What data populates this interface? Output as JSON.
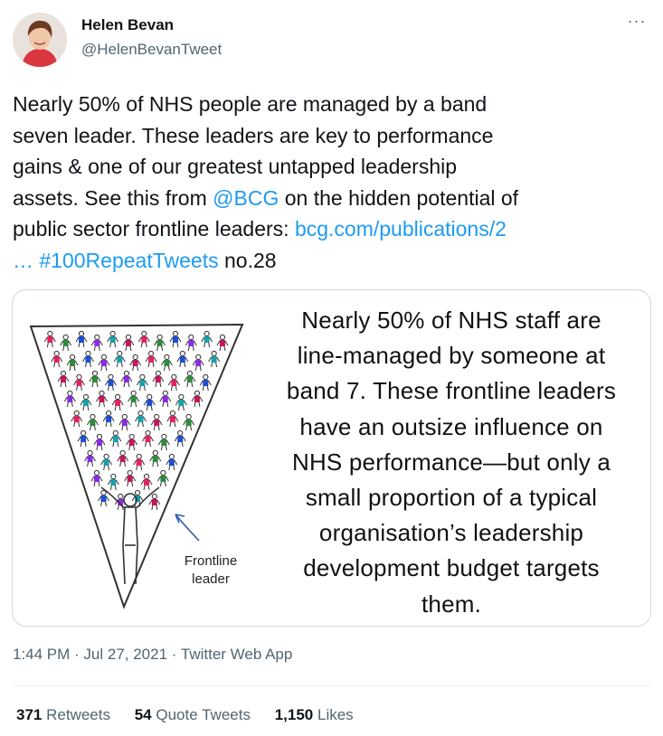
{
  "author": {
    "name": "Helen Bevan",
    "handle": "@HelenBevanTweet",
    "avatar_icon": "profile-photo-avatar"
  },
  "more_icon": "···",
  "tweet": {
    "line1": "Nearly 50% of NHS people are managed by a band",
    "line2": "seven leader. These leaders are key to performance",
    "line3": "gains & one of our greatest untapped leadership",
    "line4_pre": "assets. See this from ",
    "mention": "@BCG",
    "line4_post": " on the hidden potential of",
    "line5_pre": "public sector frontline leaders: ",
    "url": "bcg.com/publications/2",
    "ellipsis": "…",
    "hashtag": "#100RepeatTweets",
    "suffix": " no.28"
  },
  "image": {
    "lines": [
      "Nearly 50% of NHS staff are",
      "line-managed by someone at",
      "band 7. These frontline leaders",
      "have an outsize influence on",
      "NHS performance—but  only a",
      "small proportion of a typical",
      "organisation’s leadership",
      "development budget targets",
      "them."
    ],
    "frontline_line1": "Frontline",
    "frontline_line2": "leader"
  },
  "meta": {
    "time": "1:44 PM",
    "sep1": " · ",
    "date": "Jul 27, 2021",
    "sep2": " · ",
    "source": "Twitter Web App"
  },
  "stats": {
    "retweets_count": "371",
    "retweets_label": "Retweets",
    "quotes_count": "54",
    "quotes_label": "Quote Tweets",
    "likes_count": "1,150",
    "likes_label": "Likes"
  },
  "colors": {
    "link": "#1d9bf0",
    "secondary": "#536471",
    "figures": [
      "#e0245e",
      "#2e8b3d",
      "#1f4fd1",
      "#8a2be2",
      "#1aa0a8",
      "#c2185b"
    ]
  }
}
